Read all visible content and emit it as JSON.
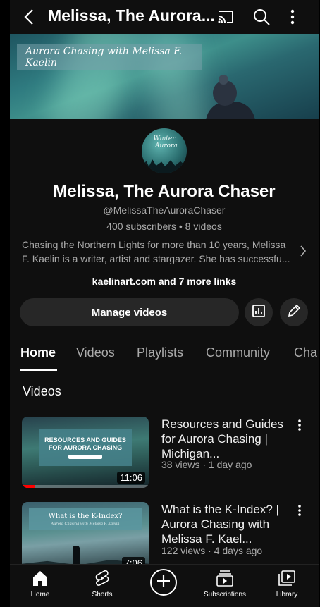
{
  "header": {
    "title": "Melissa, The Aurora...",
    "icons": [
      "back-arrow-icon",
      "cast-icon",
      "search-icon",
      "more-vert-icon"
    ]
  },
  "banner": {
    "tagline": "Aurora Chasing with Melissa F. Kaelin"
  },
  "channel": {
    "name": "Melissa, The Aurora Chaser",
    "handle": "@MelissaTheAuroraChaser",
    "stats": "400 subscribers • 8 videos",
    "description": "Chasing the Northern Lights for more than 10 years, Melissa F. Kaelin is a writer, artist and stargazer. She has successfu...",
    "links": "kaelinart.com and 7 more links"
  },
  "actions": {
    "manage_label": "Manage videos"
  },
  "tabs": [
    {
      "label": "Home",
      "active": true
    },
    {
      "label": "Videos",
      "active": false
    },
    {
      "label": "Playlists",
      "active": false
    },
    {
      "label": "Community",
      "active": false
    },
    {
      "label": "Cha",
      "active": false
    }
  ],
  "section": {
    "title": "Videos"
  },
  "videos": [
    {
      "title": "Resources and Guides for Aurora Chasing | Michigan...",
      "meta": "38 views · 1 day ago",
      "duration": "11:06",
      "thumb_text": "RESOURCES AND GUIDES FOR AURORA CHASING",
      "watch_progress": 0.1
    },
    {
      "title": "What is the K-Index? | Aurora Chasing with Melissa F. Kael...",
      "meta": "122 views · 4 days ago",
      "duration": "7:06",
      "thumb_text": "What is the K-Index?",
      "thumb_sub": "Aurora Chasing with Melissa F. Kaelin"
    }
  ],
  "bottom_nav": [
    {
      "label": "Home",
      "icon": "home-icon",
      "active": true
    },
    {
      "label": "Shorts",
      "icon": "shorts-icon"
    },
    {
      "label": "",
      "icon": "create-plus-icon"
    },
    {
      "label": "Subscriptions",
      "icon": "subscriptions-icon"
    },
    {
      "label": "Library",
      "icon": "library-icon"
    }
  ],
  "colors": {
    "background": "#0f0f0f",
    "surface": "#272727",
    "text_secondary": "#aaaaaa",
    "progress_red": "#ff0000"
  }
}
